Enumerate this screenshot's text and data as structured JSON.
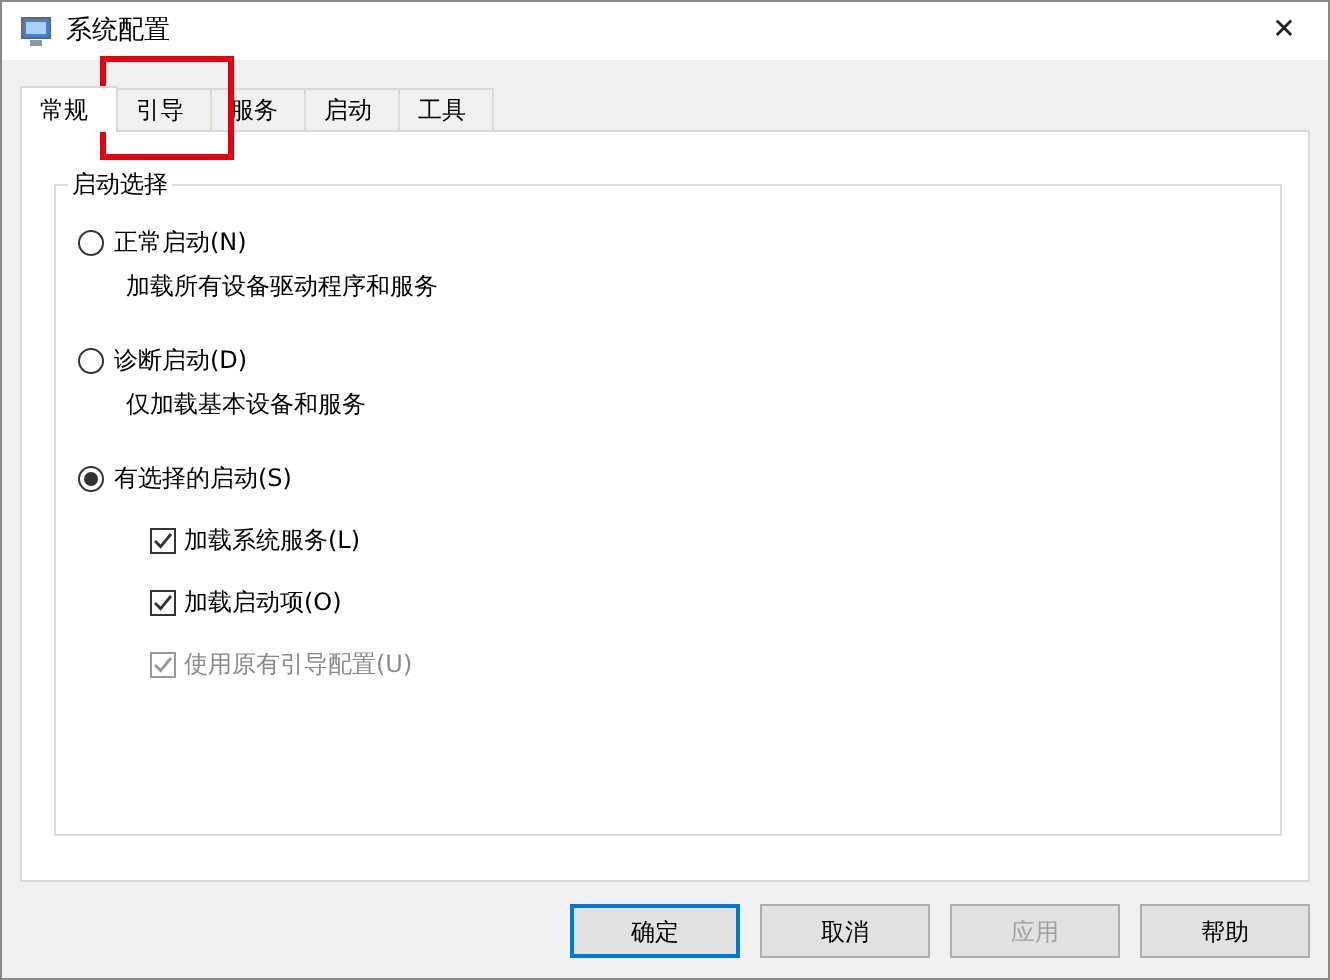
{
  "window": {
    "title": "系统配置",
    "close": "✕"
  },
  "tabs": [
    {
      "label": "常规",
      "selected": true
    },
    {
      "label": "引导",
      "selected": false
    },
    {
      "label": "服务",
      "selected": false
    },
    {
      "label": "启动",
      "selected": false
    },
    {
      "label": "工具",
      "selected": false
    }
  ],
  "group": {
    "title": "启动选择",
    "options": [
      {
        "label": "正常启动(N)",
        "description": "加载所有设备驱动程序和服务",
        "selected": false
      },
      {
        "label": "诊断启动(D)",
        "description": "仅加载基本设备和服务",
        "selected": false
      },
      {
        "label": "有选择的启动(S)",
        "selected": true,
        "checkboxes": [
          {
            "label": "加载系统服务(L)",
            "checked": true,
            "disabled": false
          },
          {
            "label": "加载启动项(O)",
            "checked": true,
            "disabled": false
          },
          {
            "label": "使用原有引导配置(U)",
            "checked": true,
            "disabled": true
          }
        ]
      }
    ]
  },
  "buttons": [
    {
      "label": "确定",
      "default": true,
      "disabled": false
    },
    {
      "label": "取消",
      "default": false,
      "disabled": false
    },
    {
      "label": "应用",
      "default": false,
      "disabled": true
    },
    {
      "label": "帮助",
      "default": false,
      "disabled": false
    }
  ]
}
